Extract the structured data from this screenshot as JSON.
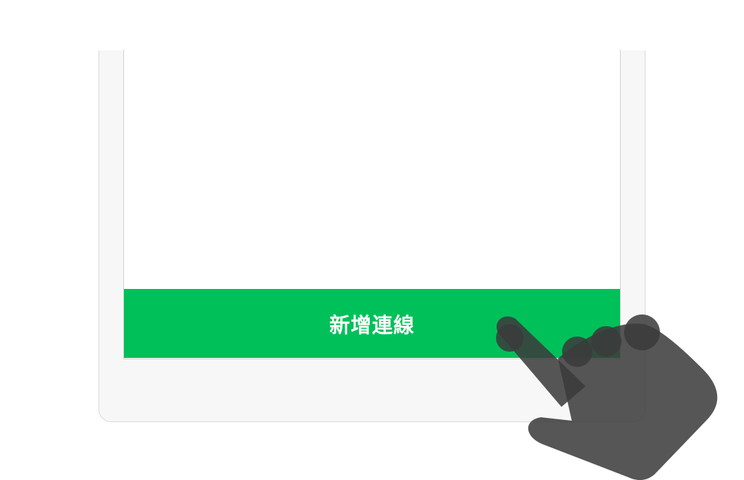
{
  "screen": {
    "primary_action_label": "新增連線"
  },
  "colors": {
    "accent": "#00c05a",
    "device_frame": "#f7f7f7",
    "hand": "#3a3a3a"
  },
  "icons": {
    "gesture": "tap-hand-icon"
  }
}
